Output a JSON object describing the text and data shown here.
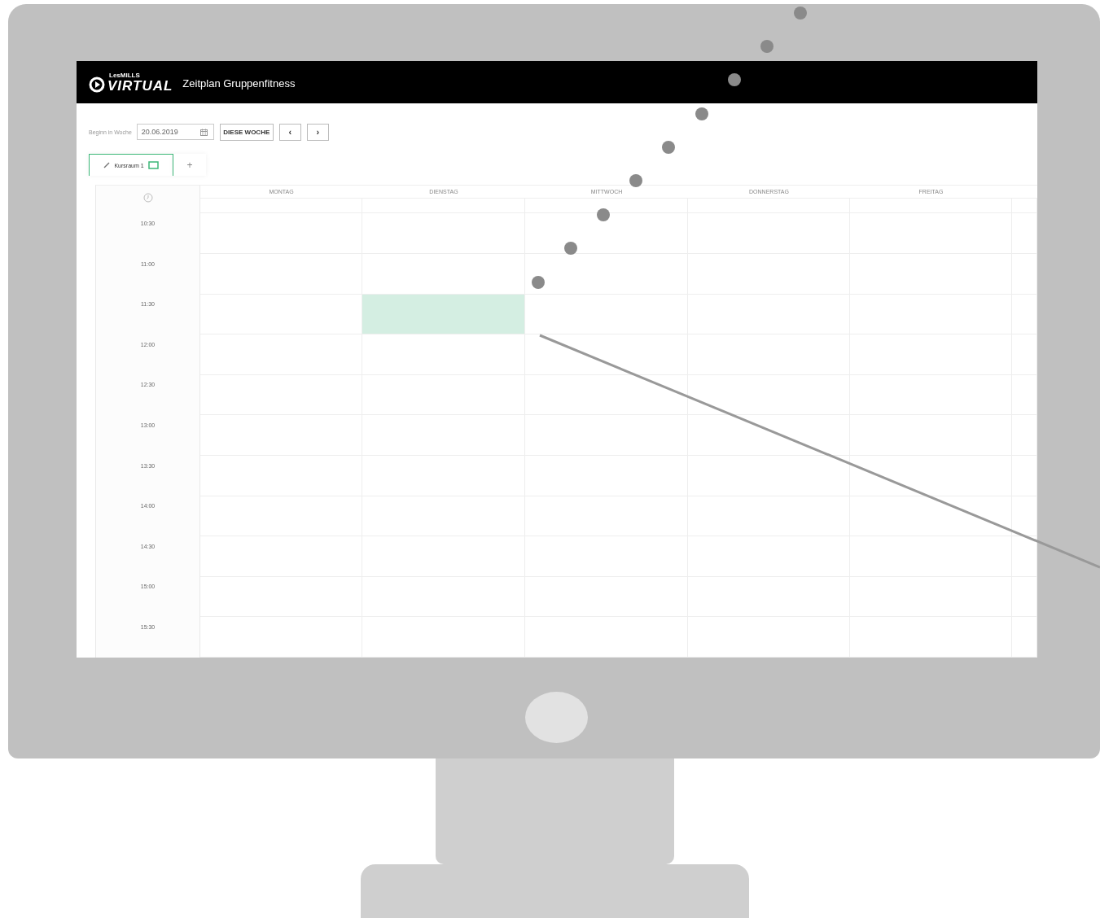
{
  "header": {
    "logo_small": "LesMILLS",
    "logo_large": "VIRTUAL",
    "title": "Zeitplan Gruppenfitness"
  },
  "toolbar": {
    "week_label": "Beginn in Woche",
    "date_value": "20.06.2019",
    "this_week_button": "DIESE WOCHE",
    "prev_button": "‹",
    "next_button": "›"
  },
  "tabs": [
    {
      "label": "Kursraum 1",
      "selected": true
    }
  ],
  "add_tab": "+",
  "days": [
    {
      "label": "MONTAG"
    },
    {
      "label": "DIENSTAG"
    },
    {
      "label": "MITTWOCH"
    },
    {
      "label": "DONNERSTAG"
    },
    {
      "label": "FREITAG"
    }
  ],
  "time_slots": [
    {
      "label": "10:30",
      "cells": [
        {
          "selected": false
        },
        {
          "selected": false
        },
        {
          "selected": false
        },
        {
          "selected": false
        },
        {
          "selected": false
        }
      ]
    },
    {
      "label": "11:00",
      "cells": [
        {
          "selected": false
        },
        {
          "selected": false
        },
        {
          "selected": false
        },
        {
          "selected": false
        },
        {
          "selected": false
        }
      ]
    },
    {
      "label": "11:30",
      "cells": [
        {
          "selected": false
        },
        {
          "selected": true
        },
        {
          "selected": false
        },
        {
          "selected": false
        },
        {
          "selected": false
        }
      ]
    },
    {
      "label": "12:00",
      "cells": [
        {
          "selected": false
        },
        {
          "selected": false
        },
        {
          "selected": false
        },
        {
          "selected": false
        },
        {
          "selected": false
        }
      ]
    },
    {
      "label": "12:30",
      "cells": [
        {
          "selected": false
        },
        {
          "selected": false
        },
        {
          "selected": false
        },
        {
          "selected": false
        },
        {
          "selected": false
        }
      ]
    },
    {
      "label": "13:00",
      "cells": [
        {
          "selected": false
        },
        {
          "selected": false
        },
        {
          "selected": false
        },
        {
          "selected": false
        },
        {
          "selected": false
        }
      ]
    },
    {
      "label": "13:30",
      "cells": [
        {
          "selected": false
        },
        {
          "selected": false
        },
        {
          "selected": false
        },
        {
          "selected": false
        },
        {
          "selected": false
        }
      ]
    },
    {
      "label": "14:00",
      "cells": [
        {
          "selected": false
        },
        {
          "selected": false
        },
        {
          "selected": false
        },
        {
          "selected": false
        },
        {
          "selected": false
        }
      ]
    },
    {
      "label": "14:30",
      "cells": [
        {
          "selected": false
        },
        {
          "selected": false
        },
        {
          "selected": false
        },
        {
          "selected": false
        },
        {
          "selected": false
        }
      ]
    },
    {
      "label": "15:00",
      "cells": [
        {
          "selected": false
        },
        {
          "selected": false
        },
        {
          "selected": false
        },
        {
          "selected": false
        },
        {
          "selected": false
        }
      ]
    },
    {
      "label": "15:30",
      "cells": [
        {
          "selected": false
        },
        {
          "selected": false
        },
        {
          "selected": false
        },
        {
          "selected": false
        },
        {
          "selected": false
        }
      ]
    }
  ]
}
